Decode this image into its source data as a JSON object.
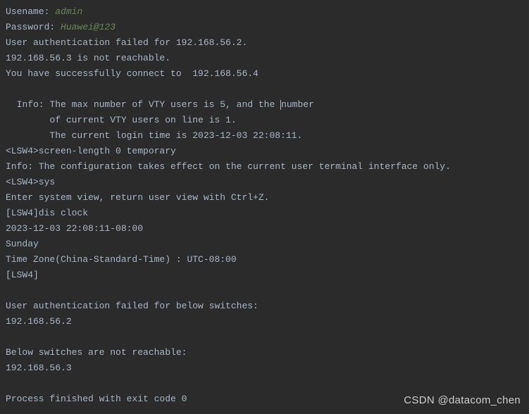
{
  "terminal": {
    "username_label": "Usename: ",
    "username_value": "admin",
    "password_label": "Password: ",
    "password_value": "Huawei@123",
    "auth_fail_line": "User authentication failed for 192.168.56.2.",
    "unreachable_line": "192.168.56.3 is not reachable.",
    "success_line": "You have successfully connect to  192.168.56.4",
    "info_line1a": "  Info: The max number of VTY users is 5, and the ",
    "info_line1b": "number",
    "info_line2": "        of current VTY users on line is 1.",
    "info_line3": "        The current login time is 2023-12-03 22:08:11.",
    "cmd1": "<LSW4>screen-length 0 temporary",
    "cmd1_result": "Info: The configuration takes effect on the current user terminal interface only.",
    "cmd2": "<LSW4>sys",
    "cmd2_result": "Enter system view, return user view with Ctrl+Z.",
    "cmd3": "[LSW4]dis clock",
    "clock_time": "2023-12-03 22:08:11-08:00",
    "clock_day": "Sunday",
    "clock_tz": "Time Zone(China-Standard-Time) : UTC-08:00",
    "prompt_end": "[LSW4]",
    "summary_fail_header": "User authentication failed for below switches:",
    "summary_fail_ip": "192.168.56.2",
    "summary_unreach_header": "Below switches are not reachable:",
    "summary_unreach_ip": "192.168.56.3",
    "exit_line": "Process finished with exit code 0"
  },
  "watermark": "CSDN @datacom_chen"
}
